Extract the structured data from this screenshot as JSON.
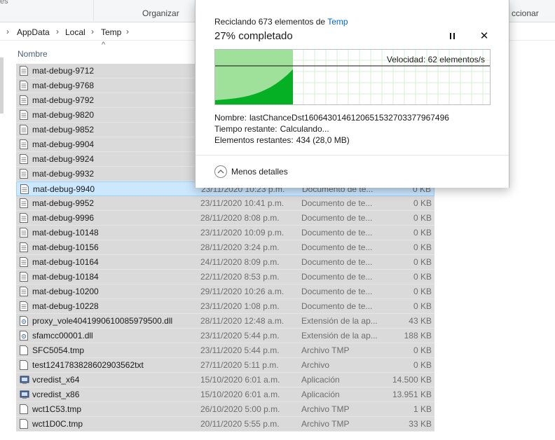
{
  "ribbon": {
    "left_fragment": "es",
    "organize": "Organizar",
    "right_fragment": "ccionar"
  },
  "address": {
    "crumbs": [
      "AppData",
      "Local",
      "Temp"
    ]
  },
  "columns": {
    "name": "Nombre"
  },
  "files": [
    {
      "name": "mat-debug-9712",
      "date": "",
      "type": "",
      "size": "",
      "icon": "text-file-icon"
    },
    {
      "name": "mat-debug-9768",
      "date": "",
      "type": "",
      "size": "",
      "icon": "text-file-icon"
    },
    {
      "name": "mat-debug-9792",
      "date": "",
      "type": "",
      "size": "",
      "icon": "text-file-icon"
    },
    {
      "name": "mat-debug-9820",
      "date": "",
      "type": "",
      "size": "",
      "icon": "text-file-icon"
    },
    {
      "name": "mat-debug-9852",
      "date": "",
      "type": "",
      "size": "",
      "icon": "text-file-icon"
    },
    {
      "name": "mat-debug-9904",
      "date": "",
      "type": "",
      "size": "",
      "icon": "text-file-icon"
    },
    {
      "name": "mat-debug-9924",
      "date": "",
      "type": "",
      "size": "",
      "icon": "text-file-icon"
    },
    {
      "name": "mat-debug-9932",
      "date": "",
      "type": "",
      "size": "",
      "icon": "text-file-icon"
    },
    {
      "name": "mat-debug-9940",
      "date": "23/11/2020 10:23 p.m.",
      "type": "Documento de te...",
      "size": "0 KB",
      "icon": "text-file-icon"
    },
    {
      "name": "mat-debug-9952",
      "date": "23/11/2020 10:41 p.m.",
      "type": "Documento de te...",
      "size": "0 KB",
      "icon": "text-file-icon"
    },
    {
      "name": "mat-debug-9996",
      "date": "28/11/2020 8:08 p.m.",
      "type": "Documento de te...",
      "size": "0 KB",
      "icon": "text-file-icon"
    },
    {
      "name": "mat-debug-10148",
      "date": "23/11/2020 10:09 p.m.",
      "type": "Documento de te...",
      "size": "0 KB",
      "icon": "text-file-icon"
    },
    {
      "name": "mat-debug-10156",
      "date": "28/11/2020 3:24 p.m.",
      "type": "Documento de te...",
      "size": "0 KB",
      "icon": "text-file-icon"
    },
    {
      "name": "mat-debug-10164",
      "date": "24/11/2020 8:09 p.m.",
      "type": "Documento de te...",
      "size": "0 KB",
      "icon": "text-file-icon"
    },
    {
      "name": "mat-debug-10184",
      "date": "22/11/2020 8:53 p.m.",
      "type": "Documento de te...",
      "size": "0 KB",
      "icon": "text-file-icon"
    },
    {
      "name": "mat-debug-10200",
      "date": "29/11/2020 10:26 a.m.",
      "type": "Documento de te...",
      "size": "0 KB",
      "icon": "text-file-icon"
    },
    {
      "name": "mat-debug-10228",
      "date": "23/11/2020 1:08 p.m.",
      "type": "Documento de te...",
      "size": "0 KB",
      "icon": "text-file-icon"
    },
    {
      "name": "proxy_vole4041990610085979500.dll",
      "date": "28/11/2020 12:48 a.m.",
      "type": "Extensión de la ap...",
      "size": "43 KB",
      "icon": "dll-file-icon"
    },
    {
      "name": "sfamcc00001.dll",
      "date": "23/11/2020 5:44 p.m.",
      "type": "Extensión de la ap...",
      "size": "188 KB",
      "icon": "dll-file-icon"
    },
    {
      "name": "SFC5054.tmp",
      "date": "23/11/2020 5:44 p.m.",
      "type": "Archivo TMP",
      "size": "0 KB",
      "icon": "blank-file-icon"
    },
    {
      "name": "test124178382860290356​2txt",
      "date": "27/11/2020 5:11 p.m.",
      "type": "Archivo",
      "size": "0 KB",
      "icon": "blank-file-icon"
    },
    {
      "name": "vcredist_x64",
      "date": "15/10/2020 6:01 a.m.",
      "type": "Aplicación",
      "size": "14.500 KB",
      "icon": "installer-icon"
    },
    {
      "name": "vcredist_x86",
      "date": "15/10/2020 6:01 a.m.",
      "type": "Aplicación",
      "size": "13.951 KB",
      "icon": "installer-icon"
    },
    {
      "name": "wct1C53.tmp",
      "date": "26/10/2020 5:00 p.m.",
      "type": "Archivo TMP",
      "size": "1 KB",
      "icon": "blank-file-icon"
    },
    {
      "name": "wct1D0C.tmp",
      "date": "20/11/2020 5:55 p.m.",
      "type": "Archivo TMP",
      "size": "33 KB",
      "icon": "blank-file-icon"
    }
  ],
  "focused_file_index": 8,
  "dialog": {
    "title_prefix": "Reciclando 673 elementos de ",
    "title_link": "Temp",
    "percent_text": "27% completado",
    "progress": 0.27,
    "speed_label": "Velocidad: 62 elementos/s",
    "name_label": "Nombre:",
    "name_value": "lastChanceDst1606430146120651532703377967496",
    "time_label": "Tiempo restante:",
    "time_value": "Calculando...",
    "remaining_label": "Elementos restantes:",
    "remaining_value": "434 (28,0 MB)",
    "less_details": "Menos detalles",
    "pause_icon": "pause-icon",
    "close_icon": "close-icon"
  },
  "colors": {
    "selection": "#dadada",
    "focus": "#cce8ff",
    "graph_fill": "#06b025",
    "graph_bg": "#9fe09a",
    "link": "#0066cc"
  }
}
